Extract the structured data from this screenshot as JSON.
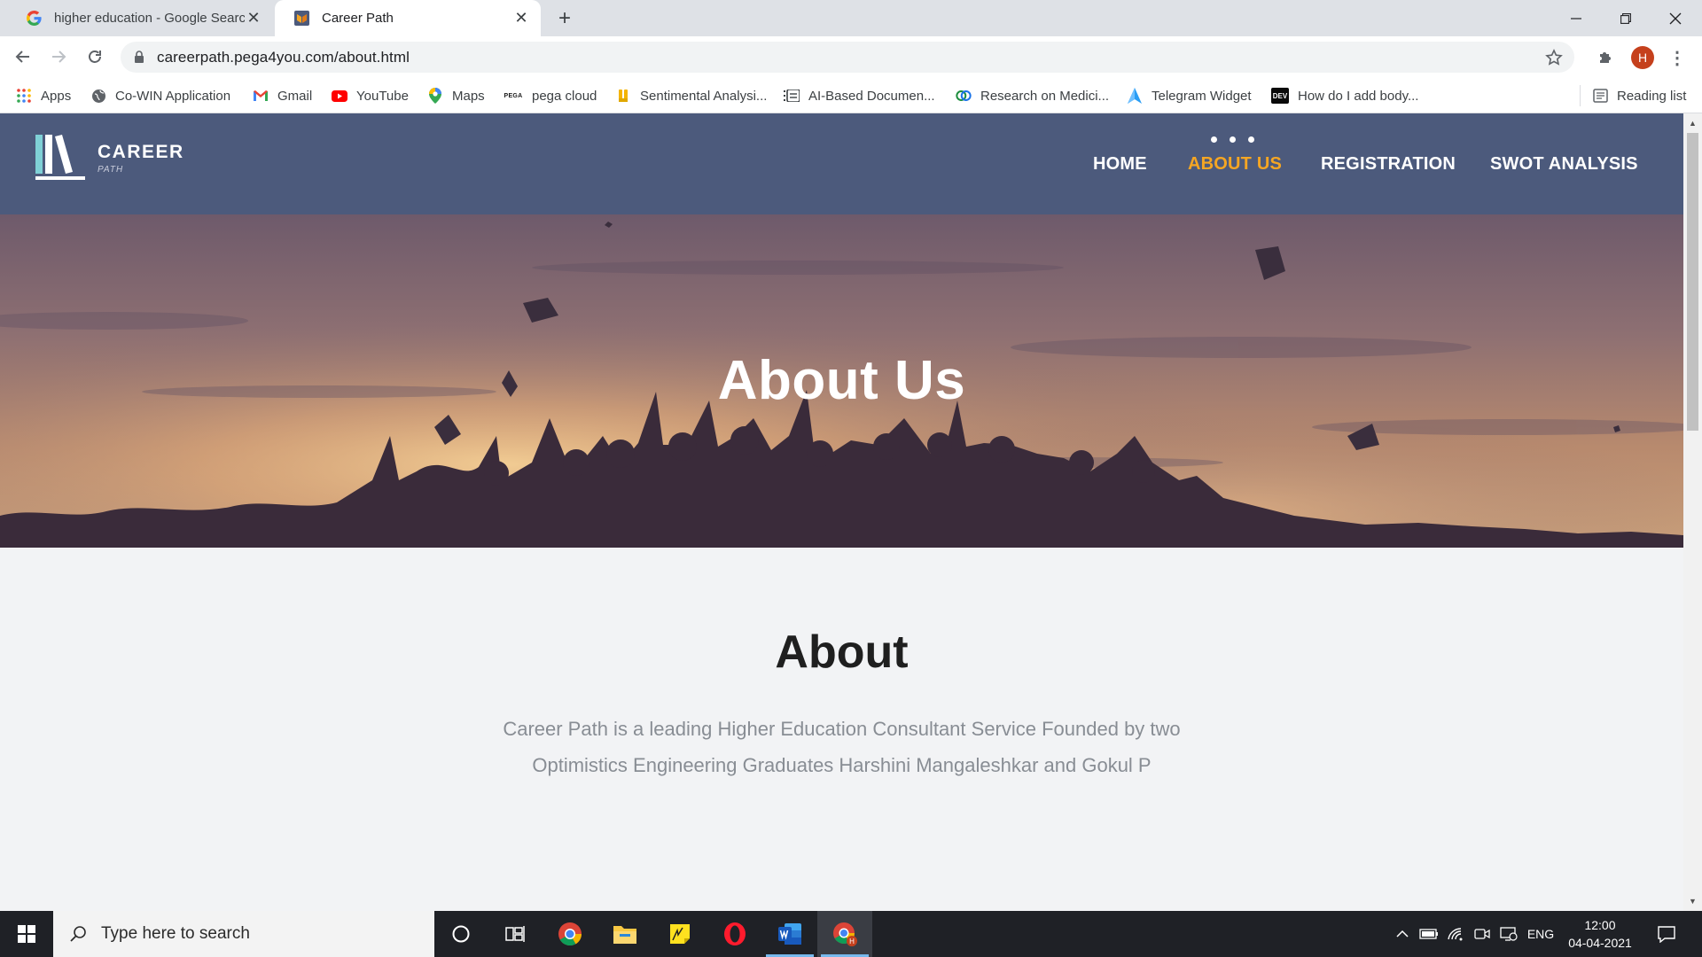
{
  "browser": {
    "tabs": [
      {
        "title": "higher education - Google Search",
        "active": false
      },
      {
        "title": "Career Path",
        "active": true
      }
    ],
    "url": "careerpath.pega4you.com/about.html",
    "profile_initial": "H",
    "bookmarks": [
      {
        "label": "Apps",
        "icon": "apps-grid-icon"
      },
      {
        "label": "Co-WIN Application",
        "icon": "globe-icon"
      },
      {
        "label": "Gmail",
        "icon": "gmail-icon"
      },
      {
        "label": "YouTube",
        "icon": "youtube-icon"
      },
      {
        "label": "Maps",
        "icon": "maps-pin-icon"
      },
      {
        "label": "pega cloud",
        "icon": "pega-icon"
      },
      {
        "label": "Sentimental Analysi...",
        "icon": "bookmark-app-icon"
      },
      {
        "label": "AI-Based Documen...",
        "icon": "list-icon"
      },
      {
        "label": "Research on Medici...",
        "icon": "ring-logo-icon"
      },
      {
        "label": "Telegram Widget",
        "icon": "telegram-icon"
      },
      {
        "label": "How do I add body...",
        "icon": "dev-icon"
      }
    ],
    "reading_list": "Reading list"
  },
  "site": {
    "logo_title": "CAREER",
    "logo_subtitle": "PATH",
    "nav": [
      {
        "label": "HOME",
        "active": false
      },
      {
        "label": "ABOUT US",
        "active": true
      },
      {
        "label": "REGISTRATION",
        "active": false
      },
      {
        "label": "SWOT ANALYSIS",
        "active": false
      }
    ],
    "hero_title": "About Us",
    "about_heading": "About",
    "about_text": "Career Path is a leading Higher Education Consultant Service Founded by two Optimistics Engineering Graduates Harshini Mangaleshkar and Gokul P"
  },
  "taskbar": {
    "search_placeholder": "Type here to search",
    "language": "ENG",
    "time": "12:00",
    "date": "04-04-2021"
  },
  "colors": {
    "header_bg": "#4c5a7c",
    "nav_active": "#f5a623",
    "page_bg": "#f2f3f5"
  }
}
